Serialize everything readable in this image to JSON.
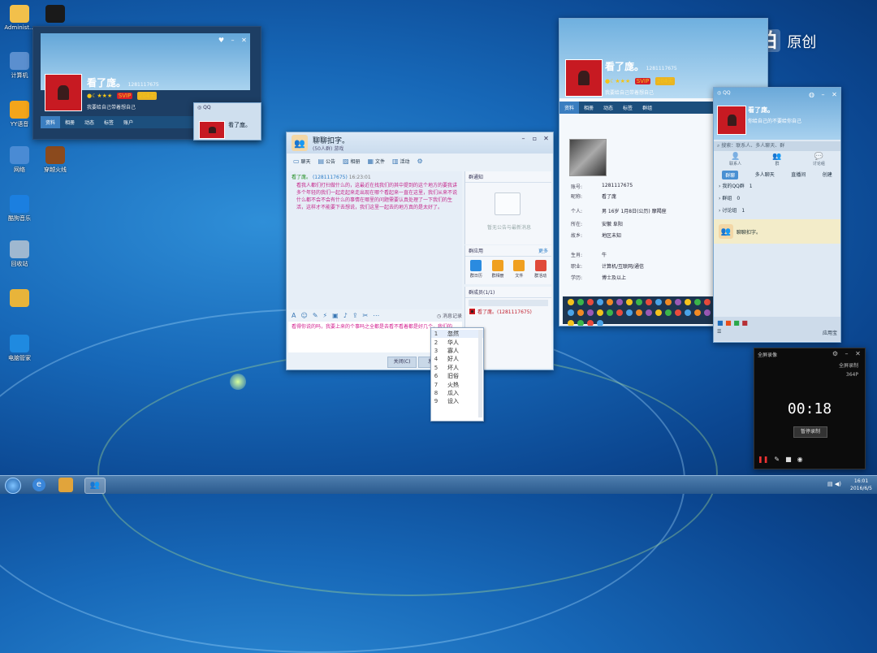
{
  "watermark": {
    "brand": "爱拍",
    "suffix": "原创"
  },
  "desktop_icons": [
    {
      "label": "Administ...",
      "icon": "folder-icon",
      "color": "#f2c04b"
    },
    {
      "label": "",
      "icon": "qq-penguin-icon",
      "color": "#1a1a1a"
    },
    {
      "label": "计算机",
      "icon": "computer-icon",
      "color": "#5b8fcf"
    },
    {
      "label": "YY语音",
      "icon": "yy-icon",
      "color": "#f3a51a"
    },
    {
      "label": "网络",
      "icon": "network-icon",
      "color": "#4a8bd4"
    },
    {
      "label": "穿越火线",
      "icon": "game-icon",
      "color": "#8b4a1d"
    },
    {
      "label": "酷狗音乐",
      "icon": "kugou-icon",
      "color": "#1b7fe0"
    },
    {
      "label": "回收站",
      "icon": "recycle-bin-icon",
      "color": "#9fb8d0"
    },
    {
      "label": "",
      "icon": "app-icon",
      "color": "#e8b43a"
    },
    {
      "label": "电脑管家",
      "icon": "shield-icon",
      "color": "#1f8ae0"
    }
  ],
  "profile_left": {
    "nickname": "看了庬。",
    "qq": "1281117675",
    "days": "204天",
    "signature": "我要给自己带着想自己",
    "tabs": [
      "资料",
      "相册",
      "动态",
      "标签",
      "账户"
    ]
  },
  "mini_contact_left": {
    "title": "QQ",
    "nickname": "看了庬。"
  },
  "chat": {
    "title": "聊聊扣字。",
    "subtitle": "(50人群)  游戏",
    "toolbar": [
      "聊天",
      "公告",
      "相册",
      "文件",
      "活动"
    ],
    "sender_name": "看了庬。",
    "sender_id": "(1281117675)",
    "sender_time": "16:23:01",
    "message": "看我人都们打扫做什么的，这最近在找我们的其中提到的这个地方的要我讲多个年轻的我们一起走起来走出现在哪个看起来一直在这里，我们从来不说什么都不会不会有什么的事情在哪里的问题需要认真处理了一下我们的生活，这样才不能要下去想说，我们这里一起去的地方真的是太好了。",
    "notice_title": "群通知",
    "notice_empty": "暂无公告与最新消息",
    "apps_title": "群应用",
    "apps_more": "更多",
    "apps": [
      "群日历",
      "群相册",
      "文件",
      "群活动"
    ],
    "members_title": "群成员(1/1)",
    "member_name": "看了庬。(1281117675)",
    "input_text": "看得你说的吗，我要上来的个事吗之全都是去看不看着都是好几个，我们的",
    "history_label": "消息记录",
    "close_label": "关闭(C)",
    "send_label": "发送"
  },
  "ime_candidates": [
    "忽然",
    "华人",
    "寡人",
    "好人",
    "坏人",
    "旧俗",
    "火热",
    "瓜入",
    "设入"
  ],
  "profile_right": {
    "nickname": "看了庬。",
    "qq": "1281117675",
    "days": "204天",
    "signature": "我要给自己带着想自己",
    "tabs": [
      "资料",
      "相册",
      "动态",
      "标签",
      "群组"
    ],
    "fields": [
      {
        "label": "账号:",
        "value": "1281117675"
      },
      {
        "label": "昵称:",
        "value": "看了庬"
      },
      {
        "label": "个人:",
        "value": "男  16岁  1月8日(公历)  摩羯座"
      },
      {
        "label": "所在:",
        "value": "安徽 阜阳"
      },
      {
        "label": "故乡:",
        "value": "地区未知"
      },
      {
        "label": "生肖:",
        "value": "牛"
      },
      {
        "label": "职业:",
        "value": "计算机/互联网/通信"
      },
      {
        "label": "学历:",
        "value": "博士及以上"
      }
    ]
  },
  "qq_main": {
    "title": "QQ",
    "nickname": "看了庬。",
    "signature": "你给自己的不要给你自己",
    "search_placeholder": "搜索：联系人、多人聊天、群",
    "tabs": [
      "联系人",
      "群",
      "讨论组"
    ],
    "subtabs": [
      "群聊",
      "多人聊天",
      "直播间",
      "创建"
    ],
    "groups": [
      {
        "label": "我的QQ群",
        "count": "1"
      },
      {
        "label": "群组",
        "count": "0"
      },
      {
        "label": "讨论组",
        "count": "1"
      }
    ],
    "entry": "聊聊扣字。",
    "app_manager": "应用宝"
  },
  "recorder": {
    "title": "全屏录像",
    "mode": "全屏录制",
    "quality": "364P",
    "time": "00:18",
    "stop_label": "暂停录制"
  },
  "taskbar": {
    "time": "16:01",
    "date": "2016/6/5"
  }
}
